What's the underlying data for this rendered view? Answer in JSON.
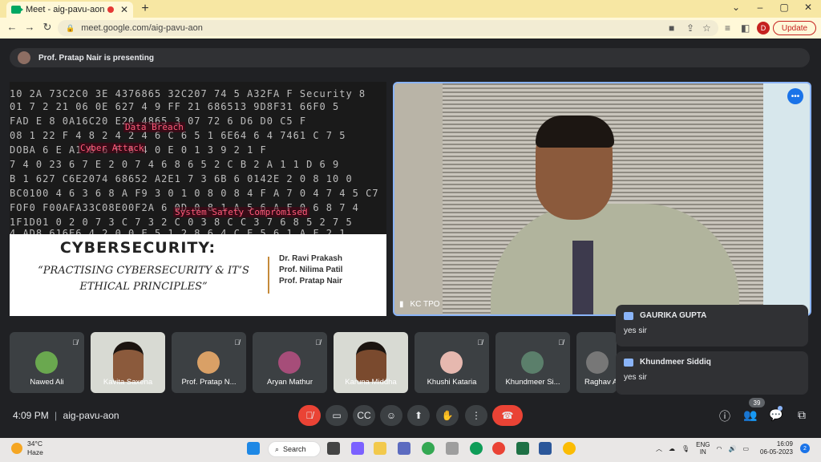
{
  "browser": {
    "tab_title": "Meet - aig-pavu-aon",
    "new_tab": "+",
    "url": "meet.google.com/aig-pavu-aon",
    "profile_initial": "D",
    "update_label": "Update"
  },
  "meet": {
    "presenting_banner": "Prof. Pratap Nair is presenting",
    "slide": {
      "red_labels": [
        "Data Breach",
        "Cyber Attack",
        "System Safety Compromised"
      ],
      "title": "CYBERSECURITY:",
      "subtitle_line1": "“PRACTISING CYBERSECURITY & IT’S",
      "subtitle_line2": "ETHICAL PRINCIPLES”",
      "authors": [
        "Dr. Ravi  Prakash",
        "Prof. Nilima Patil",
        "Prof. Pratap Nair"
      ]
    },
    "main_video_name": "KC TPO",
    "chats": [
      {
        "sender": "GAURIKA GUPTA",
        "message": "yes sir"
      },
      {
        "sender": "Khundmeer Siddiq",
        "message": "yes sir"
      }
    ],
    "participants": [
      {
        "name": "Nawed Ali",
        "color": "#6aa84f"
      },
      {
        "name": "Kavita Saxena",
        "color": "#ffffff"
      },
      {
        "name": "Prof. Pratap N...",
        "color": "#d9a066"
      },
      {
        "name": "Aryan Mathur",
        "color": "#a64d79"
      },
      {
        "name": "Karuna Middha",
        "color": "#ffffff"
      },
      {
        "name": "Khushi Kataria",
        "color": "#e6b8af"
      },
      {
        "name": "Khundmeer Si...",
        "color": "#5b7f6b"
      },
      {
        "name": "Raghav A",
        "color": "#777777"
      }
    ],
    "time": "4:09 PM",
    "meeting_code": "aig-pavu-aon",
    "participant_count": "39"
  },
  "taskbar": {
    "temperature": "34°C",
    "weather": "Haze",
    "search_label": "Search",
    "lang_line1": "ENG",
    "lang_line2": "IN",
    "time": "16:09",
    "date": "06-05-2023",
    "notification_count": "2"
  }
}
